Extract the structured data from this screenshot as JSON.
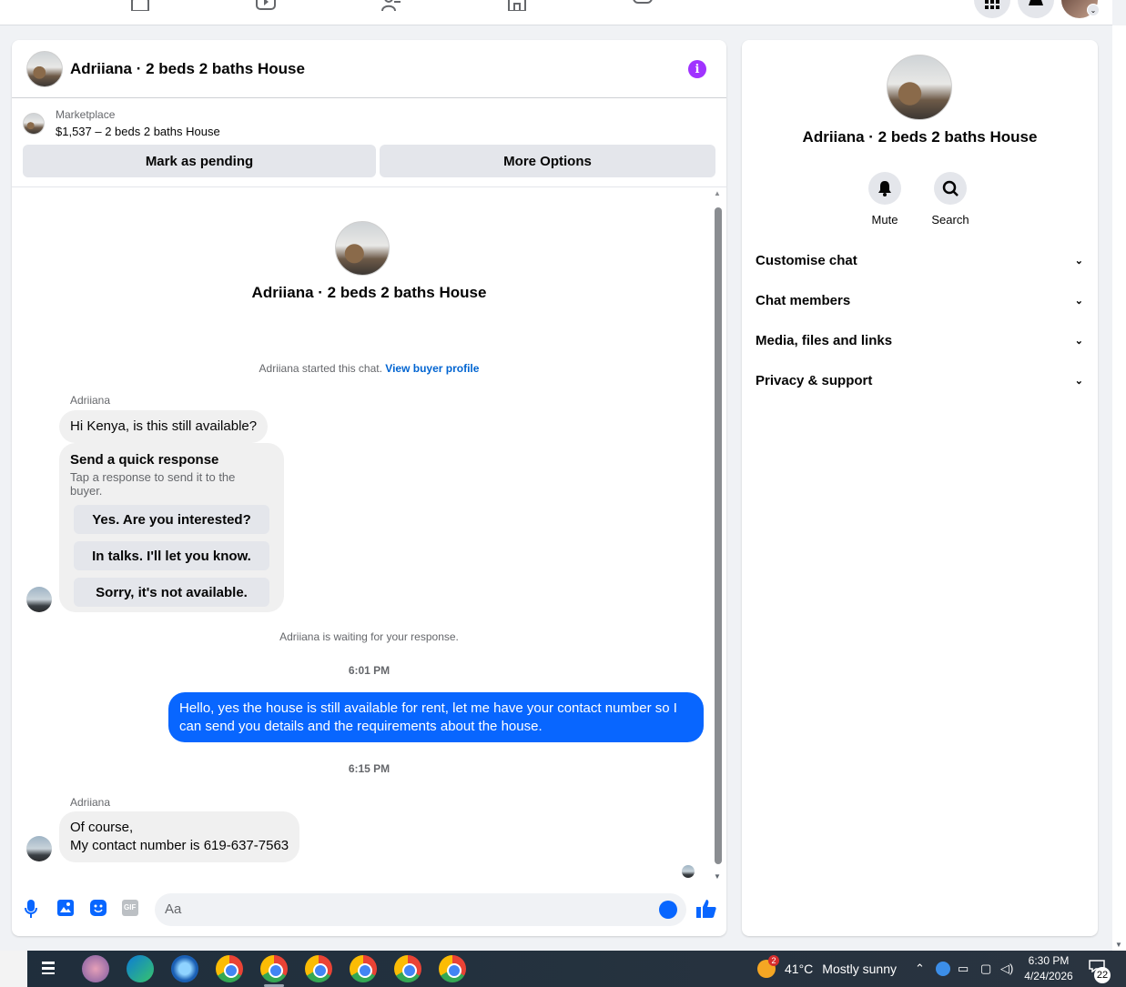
{
  "chat": {
    "title": "Adriiana · 2 beds 2 baths House",
    "marketplace_label": "Marketplace",
    "listing": "$1,537 – 2 beds 2 baths House",
    "mark_pending": "Mark as pending",
    "more_options": "More Options",
    "intro_name": "Adriiana · 2 beds 2 baths House",
    "started_text": "Adriiana started this chat.",
    "view_profile": "View buyer profile",
    "messages": [
      {
        "sender": "Adriiana",
        "text": "Hi Kenya, is this still available?"
      },
      {
        "sender": "Adriiana",
        "line1": "Of course,",
        "line2": "My contact number is 619-637-7563"
      }
    ],
    "quick_response": {
      "title": "Send a quick response",
      "subtitle": "Tap a response to send it to the buyer.",
      "options": [
        "Yes. Are you interested?",
        "In talks. I'll let you know.",
        "Sorry, it's not available."
      ]
    },
    "waiting": "Adriiana is waiting for your response.",
    "time1": "6:01 PM",
    "outgoing": "Hello, yes the house is still available for rent, let me have your contact number so I can send you details and the requirements about the house.",
    "time2": "6:15 PM",
    "composer_placeholder": "Aa",
    "gif_label": "GIF"
  },
  "side": {
    "name": "Adriiana · 2 beds 2 baths House",
    "mute": "Mute",
    "search": "Search",
    "sections": [
      "Customise chat",
      "Chat members",
      "Media, files and links",
      "Privacy & support"
    ]
  },
  "taskbar": {
    "weather_temp": "41°C",
    "weather_desc": "Mostly sunny",
    "weather_badge": "2",
    "time": "6:30 PM",
    "date": "4/24/2026",
    "notif_count": "22"
  },
  "colors": {
    "accent": "#0866ff",
    "info": "#a033ff",
    "link": "#0064d1"
  }
}
